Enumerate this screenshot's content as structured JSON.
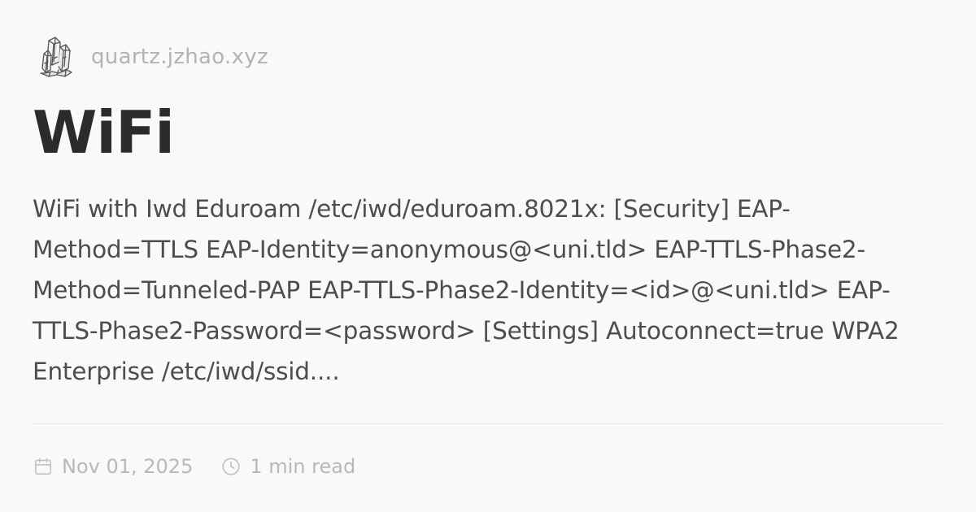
{
  "site": {
    "logo_icon": "crystal-logo-icon",
    "name": "quartz.jzhao.xyz"
  },
  "page": {
    "title": "WiFi",
    "description": "WiFi with Iwd Eduroam /etc/iwd/eduroam.8021x: [Security] EAP-Method=TTLS EAP-Identity=anonymous@<uni.tld> EAP-TTLS-Phase2-Method=Tunneled-PAP EAP-TTLS-Phase2-Identity=<id>@<uni.tld> EAP-TTLS-Phase2-Password=<password> [Settings] Autoconnect=true WPA2 Enterprise /etc/iwd/ssid...."
  },
  "meta": {
    "date_icon": "calendar-icon",
    "date": "Nov 01, 2025",
    "reading_icon": "clock-icon",
    "reading_time": "1 min read"
  },
  "colors": {
    "background": "#faf8f8",
    "title": "#2b2b2b",
    "body_text": "#4d4d4d",
    "muted": "#b8b8b8"
  }
}
